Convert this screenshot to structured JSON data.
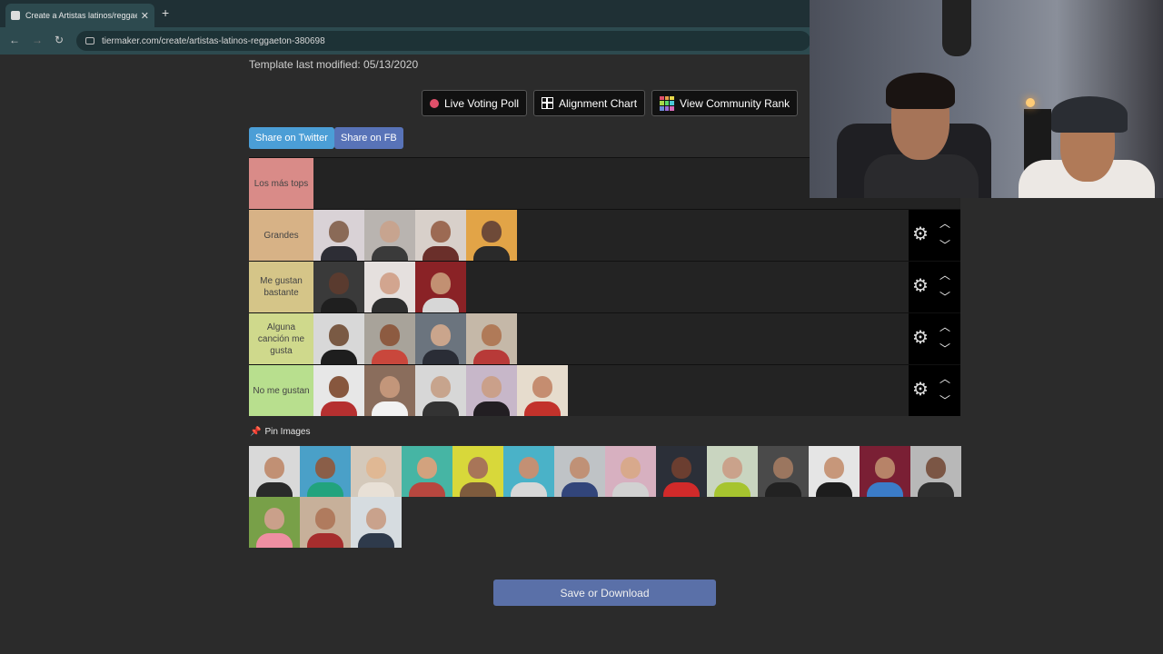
{
  "browser": {
    "tab_title": "Create a Artistas latinos/reggae",
    "url": "tiermaker.com/create/artistas-latinos-reggaeton-380698"
  },
  "page": {
    "modified": "Template last modified: 05/13/2020",
    "buttons": {
      "live_voting": "Live Voting Poll",
      "alignment": "Alignment Chart",
      "community": "View Community Rank"
    },
    "share": {
      "twitter": "Share on Twitter",
      "facebook": "Share on FB"
    },
    "pin_title": "Pin Images",
    "save": "Save or Download"
  },
  "tiers": [
    {
      "label": "Los más tops",
      "color": "#d98b88",
      "items": []
    },
    {
      "label": "Grandes",
      "color": "#d7b286",
      "items": [
        [
          "#d9d2d6",
          "#8a6a57",
          "#2d2d35"
        ],
        [
          "#b9b4b0",
          "#c7a48f",
          "#3a3a3a"
        ],
        [
          "#d8d0ca",
          "#9c6a53",
          "#6a2f2a"
        ],
        [
          "#e2a447",
          "#6e4a38",
          "#2a2a2a"
        ]
      ]
    },
    {
      "label": "Me gustan bastante",
      "color": "#d5c588",
      "items": [
        [
          "#3a3a3a",
          "#5a3b2f",
          "#1f1f1f"
        ],
        [
          "#e5e0de",
          "#d2a58f",
          "#2e2e2e"
        ],
        [
          "#8a2226",
          "#c29072",
          "#d7d7d7"
        ]
      ]
    },
    {
      "label": "Alguna canción me gusta",
      "color": "#cfd98c",
      "items": [
        [
          "#d8d8d8",
          "#7a5a44",
          "#1e1e1e"
        ],
        [
          "#a8a39a",
          "#8d5b41",
          "#c9473c"
        ],
        [
          "#6b747e",
          "#caa58c",
          "#2a2d36"
        ],
        [
          "#c5b8a8",
          "#b07a58",
          "#b83a38"
        ]
      ]
    },
    {
      "label": "No me gustan",
      "color": "#b8df8e",
      "items": [
        [
          "#e7e7e7",
          "#87573e",
          "#b53030"
        ],
        [
          "#8a6d5c",
          "#c3967a",
          "#f2f2f2"
        ],
        [
          "#d7d7d7",
          "#c7a48d",
          "#333333"
        ],
        [
          "#c7b7c9",
          "#caa08a",
          "#221e22"
        ],
        [
          "#e6dccd",
          "#c58d70",
          "#c2322b"
        ]
      ]
    }
  ],
  "pool": [
    [
      "#d9d9d9",
      "#c19074",
      "#2a2a2a"
    ],
    [
      "#4aa0c8",
      "#8a5e48",
      "#22a37d"
    ],
    [
      "#d4c9bb",
      "#e0b894",
      "#e8e0d6"
    ],
    [
      "#46b5a4",
      "#d2a27e",
      "#b7473f"
    ],
    [
      "#d8d83a",
      "#a87558",
      "#7e5b3d"
    ],
    [
      "#4ab2c8",
      "#c39074",
      "#d7d7d7"
    ],
    [
      "#bfc3c6",
      "#c09176",
      "#32457a"
    ],
    [
      "#d7b0c0",
      "#d8a98c",
      "#d1d1d1"
    ],
    [
      "#2b2f38",
      "#6b3e30",
      "#d12a2a"
    ],
    [
      "#c9d5c0",
      "#caa28b",
      "#a6c42f"
    ],
    [
      "#4a4a4a",
      "#9b765f",
      "#222222"
    ],
    [
      "#e5e5e5",
      "#c7977a",
      "#1d1d1d"
    ],
    [
      "#7a1f34",
      "#b78368",
      "#3b7cc8"
    ],
    [
      "#b8b8b8",
      "#7b5645",
      "#2f2f2f"
    ],
    [
      "#78a048",
      "#caa08a",
      "#ee8fa2"
    ],
    [
      "#c7b09a",
      "#b07b5e",
      "#a62d2d"
    ],
    [
      "#d6dce0",
      "#c9a28c",
      "#2e3a4b"
    ]
  ]
}
